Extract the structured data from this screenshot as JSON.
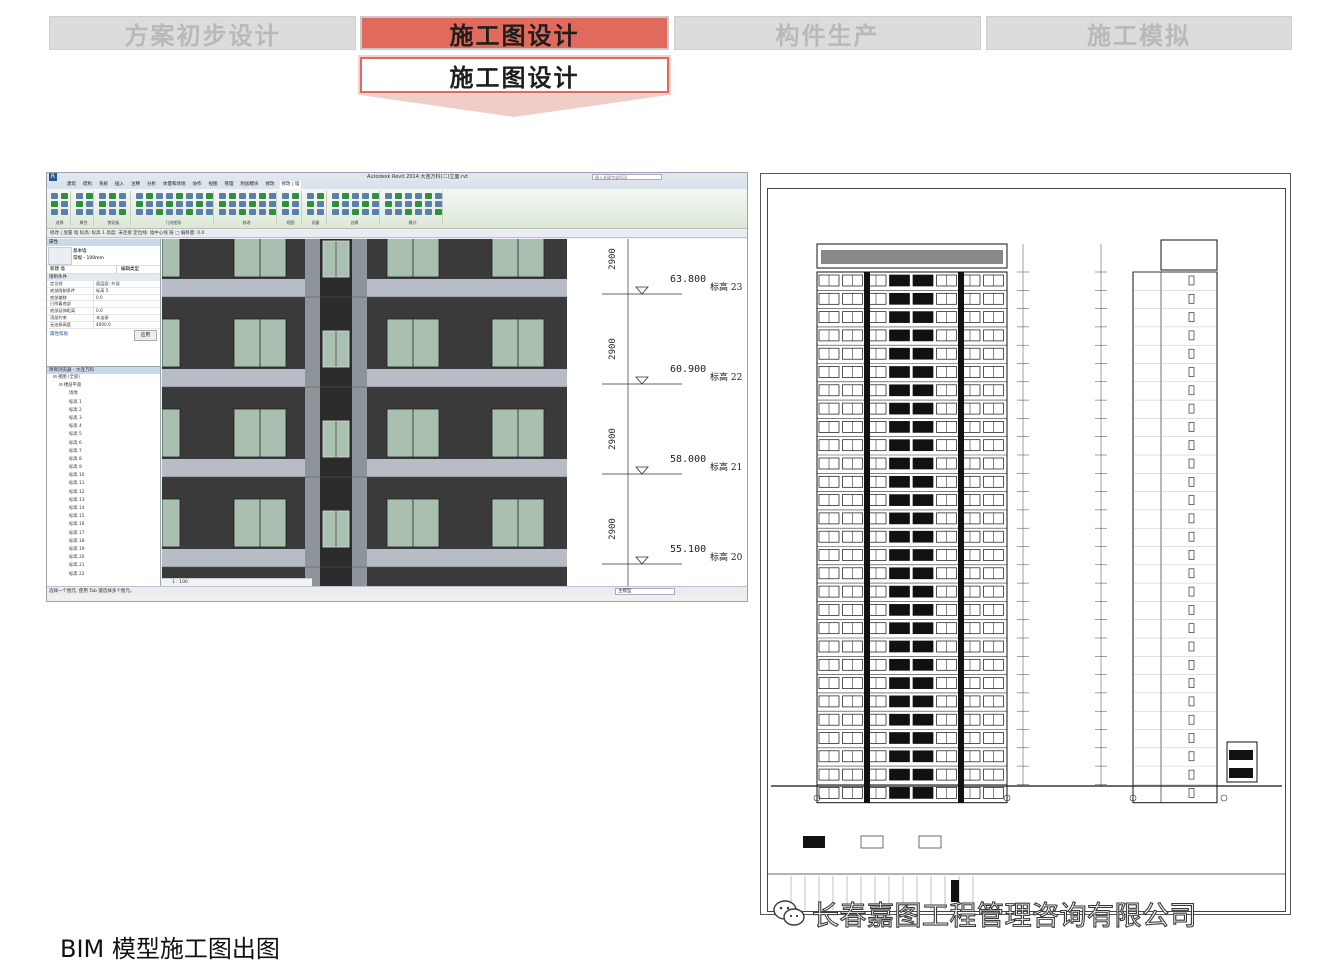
{
  "process_tabs": [
    {
      "label": "方案初步设计",
      "active": false
    },
    {
      "label": "施工图设计",
      "active": true
    },
    {
      "label": "构件生产",
      "active": false
    },
    {
      "label": "施工模拟",
      "active": false
    }
  ],
  "sub_heading": "施工图设计",
  "accent_color": "#e06b5c",
  "revit": {
    "app_title": "Autodesk Revit 2014    大连万科(二)立面.rvt",
    "search_placeholder": "键入关键字或短语",
    "ribbon_tabs": [
      "建筑",
      "结构",
      "系统",
      "插入",
      "注释",
      "分析",
      "体量和场地",
      "协作",
      "视图",
      "管理",
      "附加模块",
      "修改",
      "修改 | 墙"
    ],
    "ribbon_groups": [
      "选择",
      "属性",
      "剪贴板",
      "几何图形",
      "修改",
      "视图",
      "测量",
      "创建",
      "模式"
    ],
    "options_bar": "修改 | 放置 墙     标高: 标高 1     高度: 未连接   定位线: 墙中心线   链 □   偏移量: 0.0",
    "properties": {
      "header": "属性",
      "type_name": "基本墙",
      "type_sub": "常规 - 100mm",
      "selector": "新建 墙",
      "edit_type": "编辑类型",
      "section": "限制条件",
      "rows": [
        {
          "k": "定位线",
          "v": "面层面: 外部"
        },
        {
          "k": "底部限制条件",
          "v": "标高 5"
        },
        {
          "k": "底部偏移",
          "v": "0.0"
        },
        {
          "k": "已附着底部",
          "v": ""
        },
        {
          "k": "底部延伸距离",
          "v": "0.0"
        },
        {
          "k": "顶部约束",
          "v": "未连接"
        },
        {
          "k": "无连接高度",
          "v": "4000.0"
        }
      ],
      "help_link": "属性帮助",
      "apply_button": "应用"
    },
    "browser": {
      "header": "项目浏览器 - 大连万科",
      "items": [
        "视图 (全部)",
        "楼层平面",
        "场地",
        "标高 1",
        "标高 2",
        "标高 3",
        "标高 4",
        "标高 5",
        "标高 6",
        "标高 7",
        "标高 8",
        "标高 9",
        "标高 10",
        "标高 11",
        "标高 12",
        "标高 13",
        "标高 14",
        "标高 15",
        "标高 16",
        "标高 17",
        "标高 18",
        "标高 19",
        "标高 20",
        "标高 21",
        "标高 22"
      ]
    },
    "view_scale": "1 : 100",
    "status_text": "选择一个图元, 使用 Tab 键选择多个图元。",
    "model_label": "主模型",
    "levels": [
      {
        "elev": "63.800",
        "name": "标高 23"
      },
      {
        "elev": "60.900",
        "name": "标高 22"
      },
      {
        "elev": "58.000",
        "name": "标高 21"
      },
      {
        "elev": "55.100",
        "name": "标高 20"
      }
    ],
    "floor_height": "2900"
  },
  "caption": "BIM 模型施工图出图",
  "watermark": "长春嘉图工程管理咨询有限公司",
  "wechat_icon": "wechat-icon"
}
